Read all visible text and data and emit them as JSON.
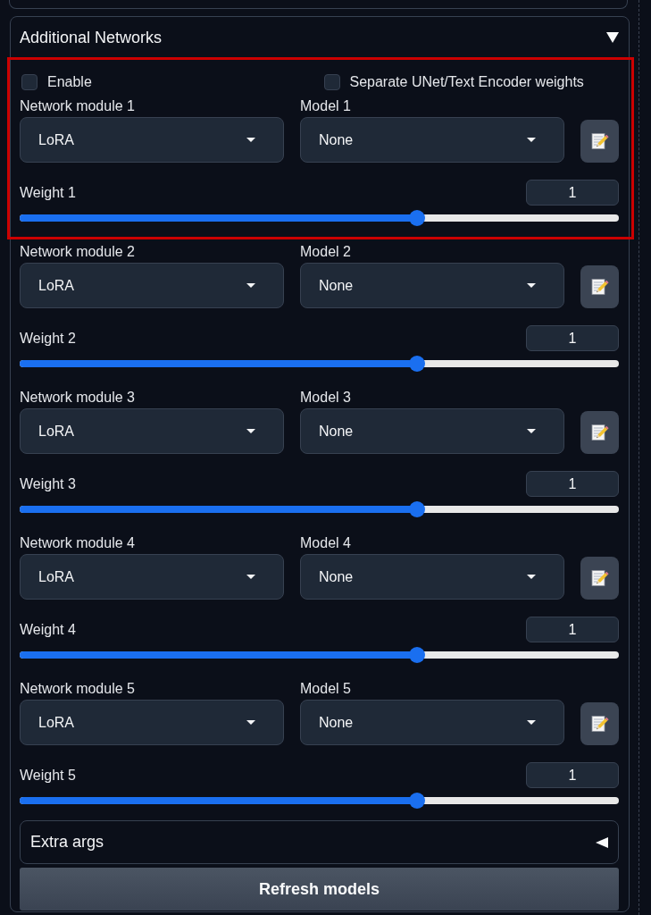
{
  "accordion": {
    "title": "Additional Networks",
    "expanded": true
  },
  "highlight": {
    "kind": "frame"
  },
  "options": [
    {
      "label": "Enable",
      "checked": false
    },
    {
      "label": "Separate UNet/Text Encoder weights",
      "checked": false
    }
  ],
  "networks": [
    {
      "module_label": "Network module 1",
      "module": "LoRA",
      "model_label": "Model 1",
      "model": "None",
      "weight_label": "Weight 1",
      "weight": "1",
      "level": 0.663
    },
    {
      "module_label": "Network module 2",
      "module": "LoRA",
      "model_label": "Model 2",
      "model": "None",
      "weight_label": "Weight 2",
      "weight": "1",
      "level": 0.663
    },
    {
      "module_label": "Network module 3",
      "module": "LoRA",
      "model_label": "Model 3",
      "model": "None",
      "weight_label": "Weight 3",
      "weight": "1",
      "level": 0.663
    },
    {
      "module_label": "Network module 4",
      "module": "LoRA",
      "model_label": "Model 4",
      "model": "None",
      "weight_label": "Weight 4",
      "weight": "1",
      "level": 0.663
    },
    {
      "module_label": "Network module 5",
      "module": "LoRA",
      "model_label": "Model 5",
      "model": "None",
      "weight_label": "Weight 5",
      "weight": "1",
      "level": 0.663
    }
  ],
  "extra_args": {
    "title": "Extra args",
    "expanded": false
  },
  "refresh_button": {
    "label": "Refresh models"
  }
}
